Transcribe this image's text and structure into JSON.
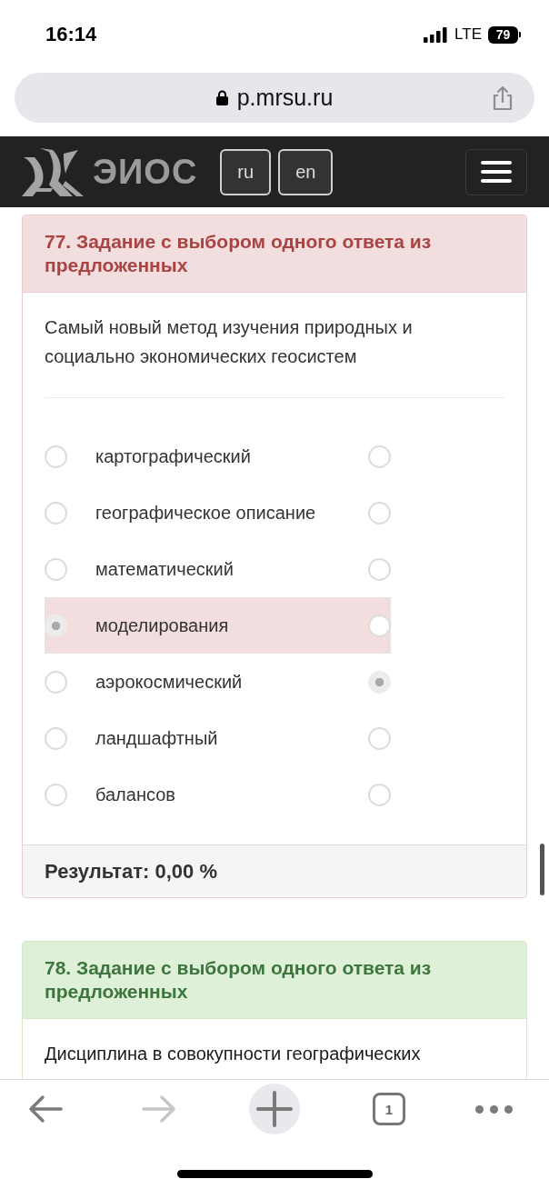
{
  "status_bar": {
    "time": "16:14",
    "network": "LTE",
    "battery": "79"
  },
  "address_bar": {
    "url": "p.mrsu.ru"
  },
  "navbar": {
    "brand": "ЭИОС",
    "languages": [
      {
        "label": "ru"
      },
      {
        "label": "en"
      }
    ]
  },
  "tasks": [
    {
      "title": "77. Задание с выбором одного ответа из предложенных",
      "passed": false,
      "question": "Самый новый метод изучения природных и социально экономических геосистем",
      "options": [
        {
          "label": "картографический",
          "selected": false,
          "correct": false
        },
        {
          "label": "географическое описание",
          "selected": false,
          "correct": false
        },
        {
          "label": "математический",
          "selected": false,
          "correct": false
        },
        {
          "label": "моделирования",
          "selected": true,
          "correct": false
        },
        {
          "label": "аэрокосмический",
          "selected": false,
          "correct": true
        },
        {
          "label": "ландшафтный",
          "selected": false,
          "correct": false
        },
        {
          "label": "балансов",
          "selected": false,
          "correct": false
        }
      ],
      "result": "Результат: 0,00 %"
    },
    {
      "title": "78. Задание с выбором одного ответа из предложенных",
      "passed": true,
      "question": "Дисциплина в совокупности географических"
    }
  ],
  "toolbar": {
    "back_disabled": false,
    "forward_disabled": true,
    "tab_count": "1"
  }
}
